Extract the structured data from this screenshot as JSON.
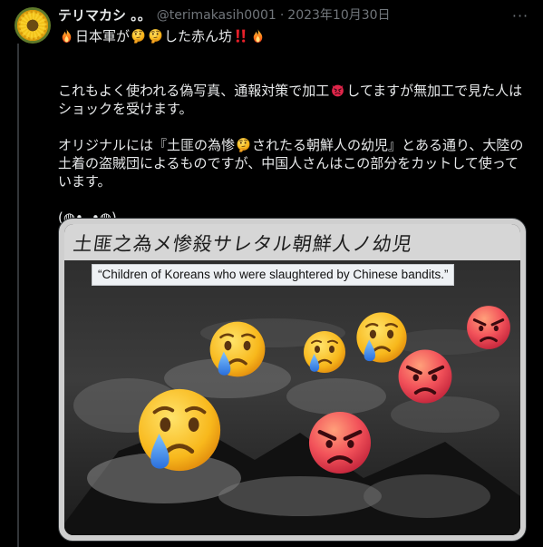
{
  "author": {
    "display_name": "テリマカシ 。。",
    "handle": "@terimakasih0001",
    "separator": "·",
    "date": "2023年10月30日"
  },
  "more_label": "···",
  "tweet": {
    "line1": [
      "日本軍が",
      "した赤ん坊"
    ],
    "para2": {
      "line1_a": "これもよく使われる偽写真、通報対策で加工",
      "line1_b": "してますが無加工で見た人は",
      "line2": "ショックを受けます。"
    },
    "para3": {
      "line1_a": "オリジナルには『土匪の為惨",
      "line1_b": "されたる朝鮮人の幼児』とある通り、大陸の",
      "line2": "土着の盗賊団によるものですが、中国人さんはこの部分をカットして使って",
      "line3": "います。"
    },
    "kaomoji": "(◍•ᴗ•◍)"
  },
  "photo": {
    "jp_caption": "土匪之為メ惨殺サレタル朝鮮人ノ幼児",
    "en_caption": "“Children of Koreans who were slaughtered by Chinese bandits.”",
    "overlay_emojis": [
      "crying-face",
      "crying-face",
      "crying-face",
      "crying-face",
      "angry-face",
      "angry-face",
      "angry-face"
    ]
  },
  "icons": {
    "fire": "fire",
    "thinking": "thinking-face",
    "double_exclamation": "double-exclamation",
    "angry_devil": "angry-face-red"
  },
  "colors": {
    "background": "#000000",
    "text_primary": "#e7e9ea",
    "text_secondary": "#71767b",
    "border": "#2f3336"
  }
}
